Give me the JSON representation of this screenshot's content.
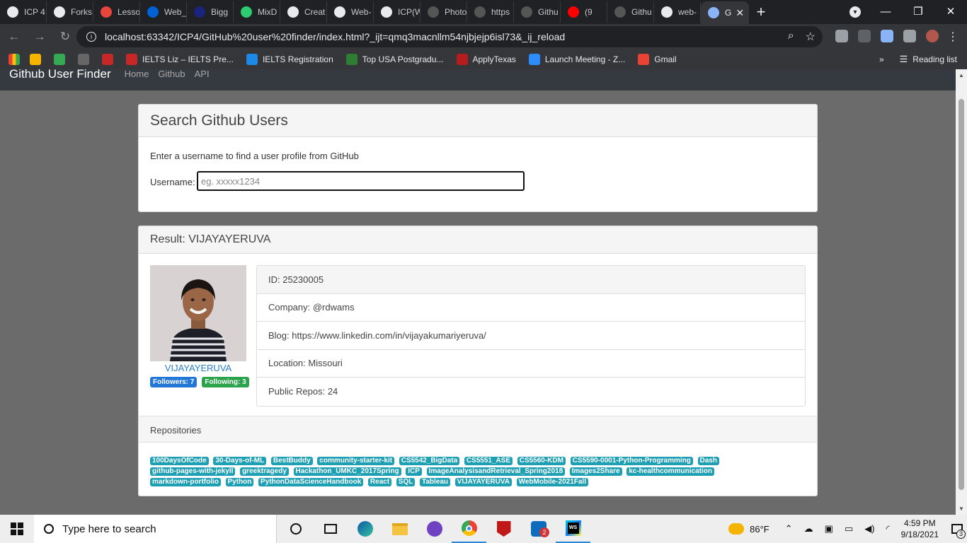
{
  "browser": {
    "tabs": [
      {
        "label": "ICP 4",
        "icon": "github-icon",
        "color": "#e8eaed"
      },
      {
        "label": "Forks",
        "icon": "github-icon",
        "color": "#e8eaed"
      },
      {
        "label": "Lesso",
        "icon": "loading-icon",
        "color": "#e8453c"
      },
      {
        "label": "Web_",
        "icon": "box-icon",
        "color": "#0061d5"
      },
      {
        "label": "Bigg",
        "icon": "page-icon",
        "color": "#1a237e"
      },
      {
        "label": "MixD",
        "icon": "m-icon",
        "color": "#2ecc71"
      },
      {
        "label": "Creat",
        "icon": "github-icon",
        "color": "#e8eaed"
      },
      {
        "label": "Web-",
        "icon": "github-icon",
        "color": "#e8eaed"
      },
      {
        "label": "ICP(W",
        "icon": "github-icon",
        "color": "#e8eaed"
      },
      {
        "label": "Photo",
        "icon": "page-icon",
        "color": "#555"
      },
      {
        "label": "https",
        "icon": "page-icon",
        "color": "#555"
      },
      {
        "label": "Githu",
        "icon": "page-icon",
        "color": "#555"
      },
      {
        "label": "(9",
        "icon": "youtube-icon",
        "color": "#ff0000"
      },
      {
        "label": "Githu",
        "icon": "page-icon",
        "color": "#555"
      },
      {
        "label": "web-",
        "icon": "github-icon",
        "color": "#e8eaed"
      }
    ],
    "active_tab": {
      "label": "G"
    },
    "address": "localhost:63342/ICP4/GitHub%20user%20finder/index.html?_ijt=qmq3macnllm54njbjejp6isl73&_ij_reload",
    "bookmarks": [
      {
        "label": "",
        "color": "#f4b400"
      },
      {
        "label": "",
        "color": "#34a853"
      },
      {
        "label": "",
        "color": "#666"
      },
      {
        "label": "",
        "color": "#c62828"
      },
      {
        "label": "IELTS Liz – IELTS Pre...",
        "color": "#c62828"
      },
      {
        "label": "IELTS Registration",
        "color": "#1e88e5"
      },
      {
        "label": "Top USA Postgradu...",
        "color": "#2e7d32"
      },
      {
        "label": "ApplyTexas",
        "color": "#b71c1c"
      },
      {
        "label": "Launch Meeting - Z...",
        "color": "#2d8cff"
      },
      {
        "label": "Gmail",
        "color": "#ea4335"
      }
    ],
    "more_bookmarks": "»",
    "reading_list": "Reading list"
  },
  "navbar": {
    "brand": "Github User Finder",
    "links": [
      "Home",
      "Github",
      "API"
    ]
  },
  "search": {
    "title": "Search Github Users",
    "hint": "Enter a username to find a user profile from GitHub",
    "label": "Username:",
    "placeholder": "eg. xxxxx1234",
    "value": ""
  },
  "result": {
    "title": "Result: VIJAYAYERUVA",
    "username": "VIJAYAYERUVA",
    "followers": "Followers: 7",
    "following": "Following: 3",
    "info": [
      "ID: 25230005",
      "Company: @rdwams",
      "Blog: https://www.linkedin.com/in/vijayakumariyeruva/",
      "Location: Missouri",
      "Public Repos: 24"
    ],
    "repos_title": "Repositories",
    "repos": [
      "100DaysOfCode",
      "30-Days-of-ML",
      "BestBuddy",
      "community-starter-kit",
      "CS5542_BigData",
      "CS5551_ASE",
      "CS5560-KDM",
      "CS5590-0001-Python-Programming",
      "Dash",
      "github-pages-with-jekyll",
      "greektragedy",
      "Hackathon_UMKC_2017Spring",
      "ICP",
      "ImageAnalysisandRetrieval_Spring2018",
      "Images2Share",
      "kc-healthcommunication",
      "markdown-portfolio",
      "Python",
      "PythonDataScienceHandbook",
      "React",
      "SQL",
      "Tableau",
      "VIJAYAYERUVA",
      "WebMobile-2021Fall"
    ]
  },
  "taskbar": {
    "search_placeholder": "Type here to search",
    "temperature": "86°F",
    "time": "4:59 PM",
    "date": "9/18/2021",
    "notifications": "3",
    "mail_badge": "2"
  },
  "colors": {
    "followers_badge": "#2277d6",
    "following_badge": "#2ba34b",
    "repo_badge": "#1d9fb4",
    "link": "#2a7fc4"
  }
}
